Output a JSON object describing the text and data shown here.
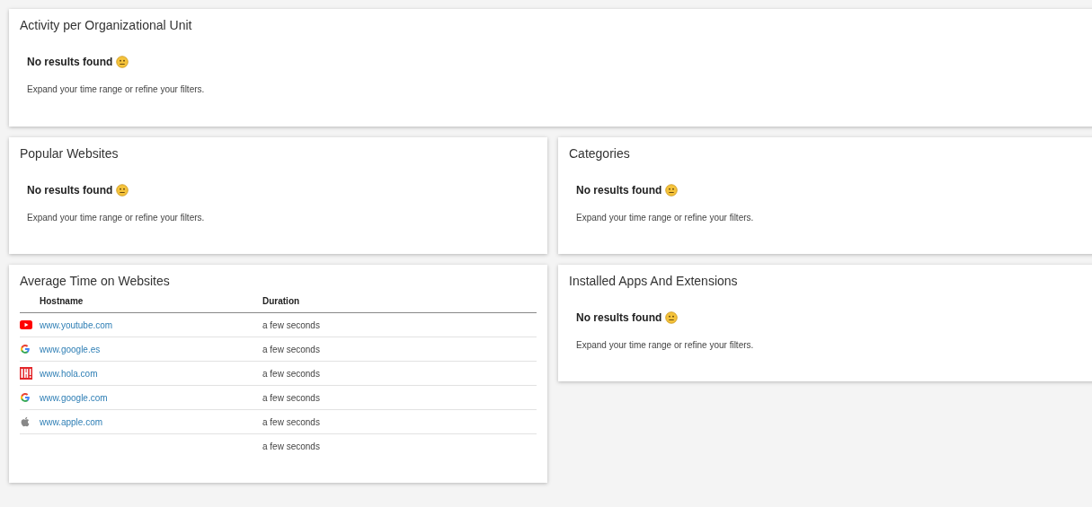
{
  "top_panel": {
    "kind": "empty",
    "title": "Activity per Organizational Unit",
    "message": "No results found",
    "hint": "Expand your time range or refine your filters."
  },
  "left_column": [
    {
      "kind": "empty",
      "title": "Popular Websites",
      "message": "No results found",
      "hint": "Expand your time range or refine your filters."
    },
    {
      "kind": "table",
      "title": "Average Time on Websites",
      "columns": [
        "Hostname",
        "Duration"
      ],
      "rows": [
        {
          "kind": "youtube",
          "hostname": "www.youtube.com",
          "duration": "a few seconds"
        },
        {
          "kind": "google",
          "hostname": "www.google.es",
          "duration": "a few seconds"
        },
        {
          "kind": "hola",
          "hostname": "www.hola.com",
          "duration": "a few seconds"
        },
        {
          "kind": "google",
          "hostname": "www.google.com",
          "duration": "a few seconds"
        },
        {
          "kind": "apple",
          "hostname": "www.apple.com",
          "duration": "a few seconds"
        },
        {
          "kind": "none",
          "duration": "a few seconds"
        }
      ]
    }
  ],
  "right_column": [
    {
      "kind": "empty",
      "title": "Categories",
      "message": "No results found",
      "hint": "Expand your time range or refine your filters."
    },
    {
      "kind": "empty",
      "title": "Installed Apps And Extensions",
      "message": "No results found",
      "hint": "Expand your time range or refine your filters."
    }
  ]
}
